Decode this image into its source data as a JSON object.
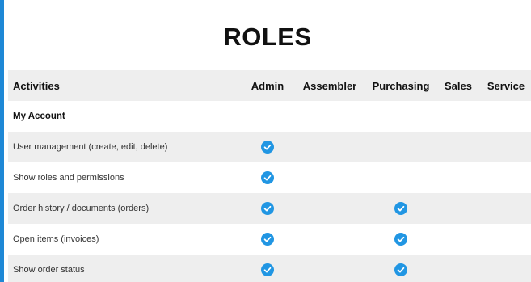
{
  "title": "ROLES",
  "table": {
    "activity_header": "Activities",
    "roles": [
      "Admin",
      "Assembler",
      "Purchasing",
      "Sales",
      "Service"
    ],
    "section": "My Account",
    "rows": [
      {
        "activity": "User management (create, edit, delete)",
        "checks": [
          true,
          false,
          false,
          false,
          false
        ]
      },
      {
        "activity": "Show roles and permissions",
        "checks": [
          true,
          false,
          false,
          false,
          false
        ]
      },
      {
        "activity": "Order history / documents (orders)",
        "checks": [
          true,
          false,
          true,
          false,
          false
        ]
      },
      {
        "activity": "Open items (invoices)",
        "checks": [
          true,
          false,
          true,
          false,
          false
        ]
      },
      {
        "activity": "Show order status",
        "checks": [
          true,
          false,
          true,
          false,
          false
        ]
      }
    ]
  },
  "colors": {
    "accent": "#1e88d6",
    "check": "#2196e3",
    "row_shade": "#eeeeee"
  },
  "icons": {
    "check": "check-circle-icon"
  }
}
